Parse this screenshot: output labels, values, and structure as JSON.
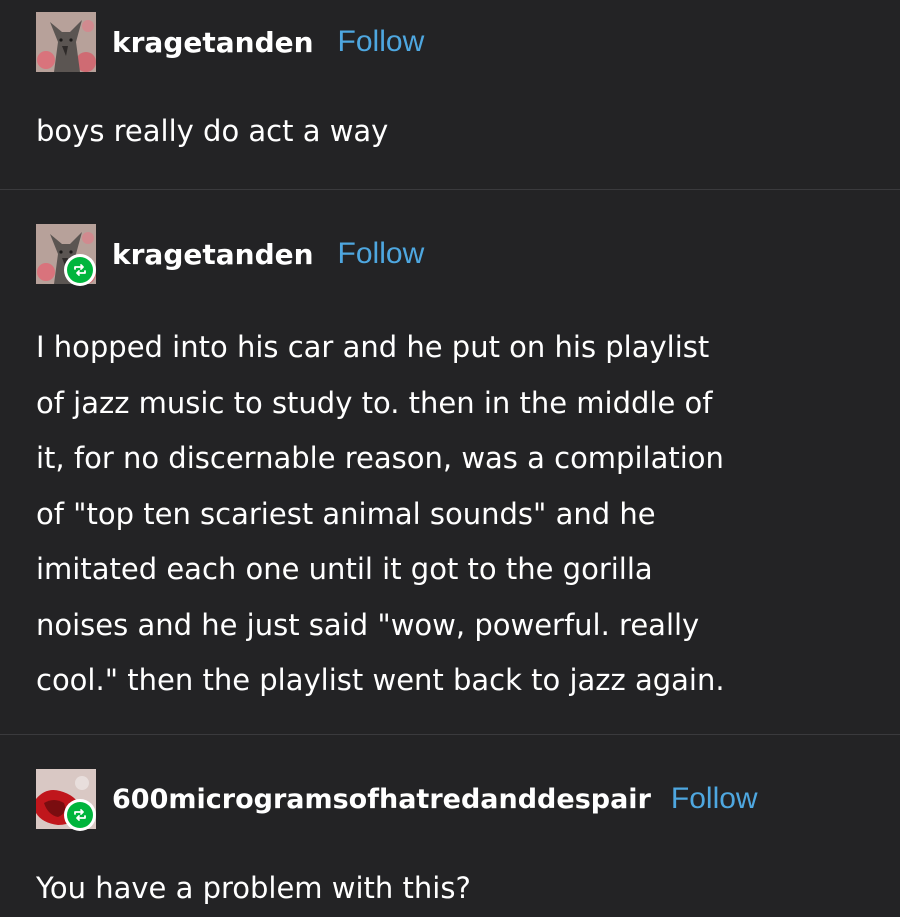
{
  "posts": [
    {
      "username": "kragetanden",
      "follow_label": "Follow",
      "reblogged": false,
      "avatar_icon": "dog-avatar-icon",
      "body_lines": [
        "boys really do act a way"
      ]
    },
    {
      "username": "kragetanden",
      "follow_label": "Follow",
      "reblogged": true,
      "avatar_icon": "dog-avatar-icon",
      "badge_icon": "reblog-icon",
      "body_lines": [
        "I hopped into his car and he put on his playlist",
        "of jazz music to study to. then in the middle of",
        "it, for no discernable reason, was a compilation",
        "of \"top ten scariest animal sounds\" and he",
        "imitated each one until it got to the gorilla",
        "noises and he just said \"wow, powerful. really",
        "cool.\" then the playlist went back to jazz again."
      ]
    },
    {
      "username": "600microgramsofhatredanddespair",
      "follow_label": "Follow",
      "reblogged": true,
      "avatar_icon": "red-abstract-avatar-icon",
      "badge_icon": "reblog-icon",
      "body_lines": [
        "You have a problem with this?"
      ]
    }
  ],
  "colors": {
    "background": "#232325",
    "follow_link": "#4ea7e0",
    "reblog_badge": "#00b53d",
    "divider": "#3a3a3d"
  }
}
